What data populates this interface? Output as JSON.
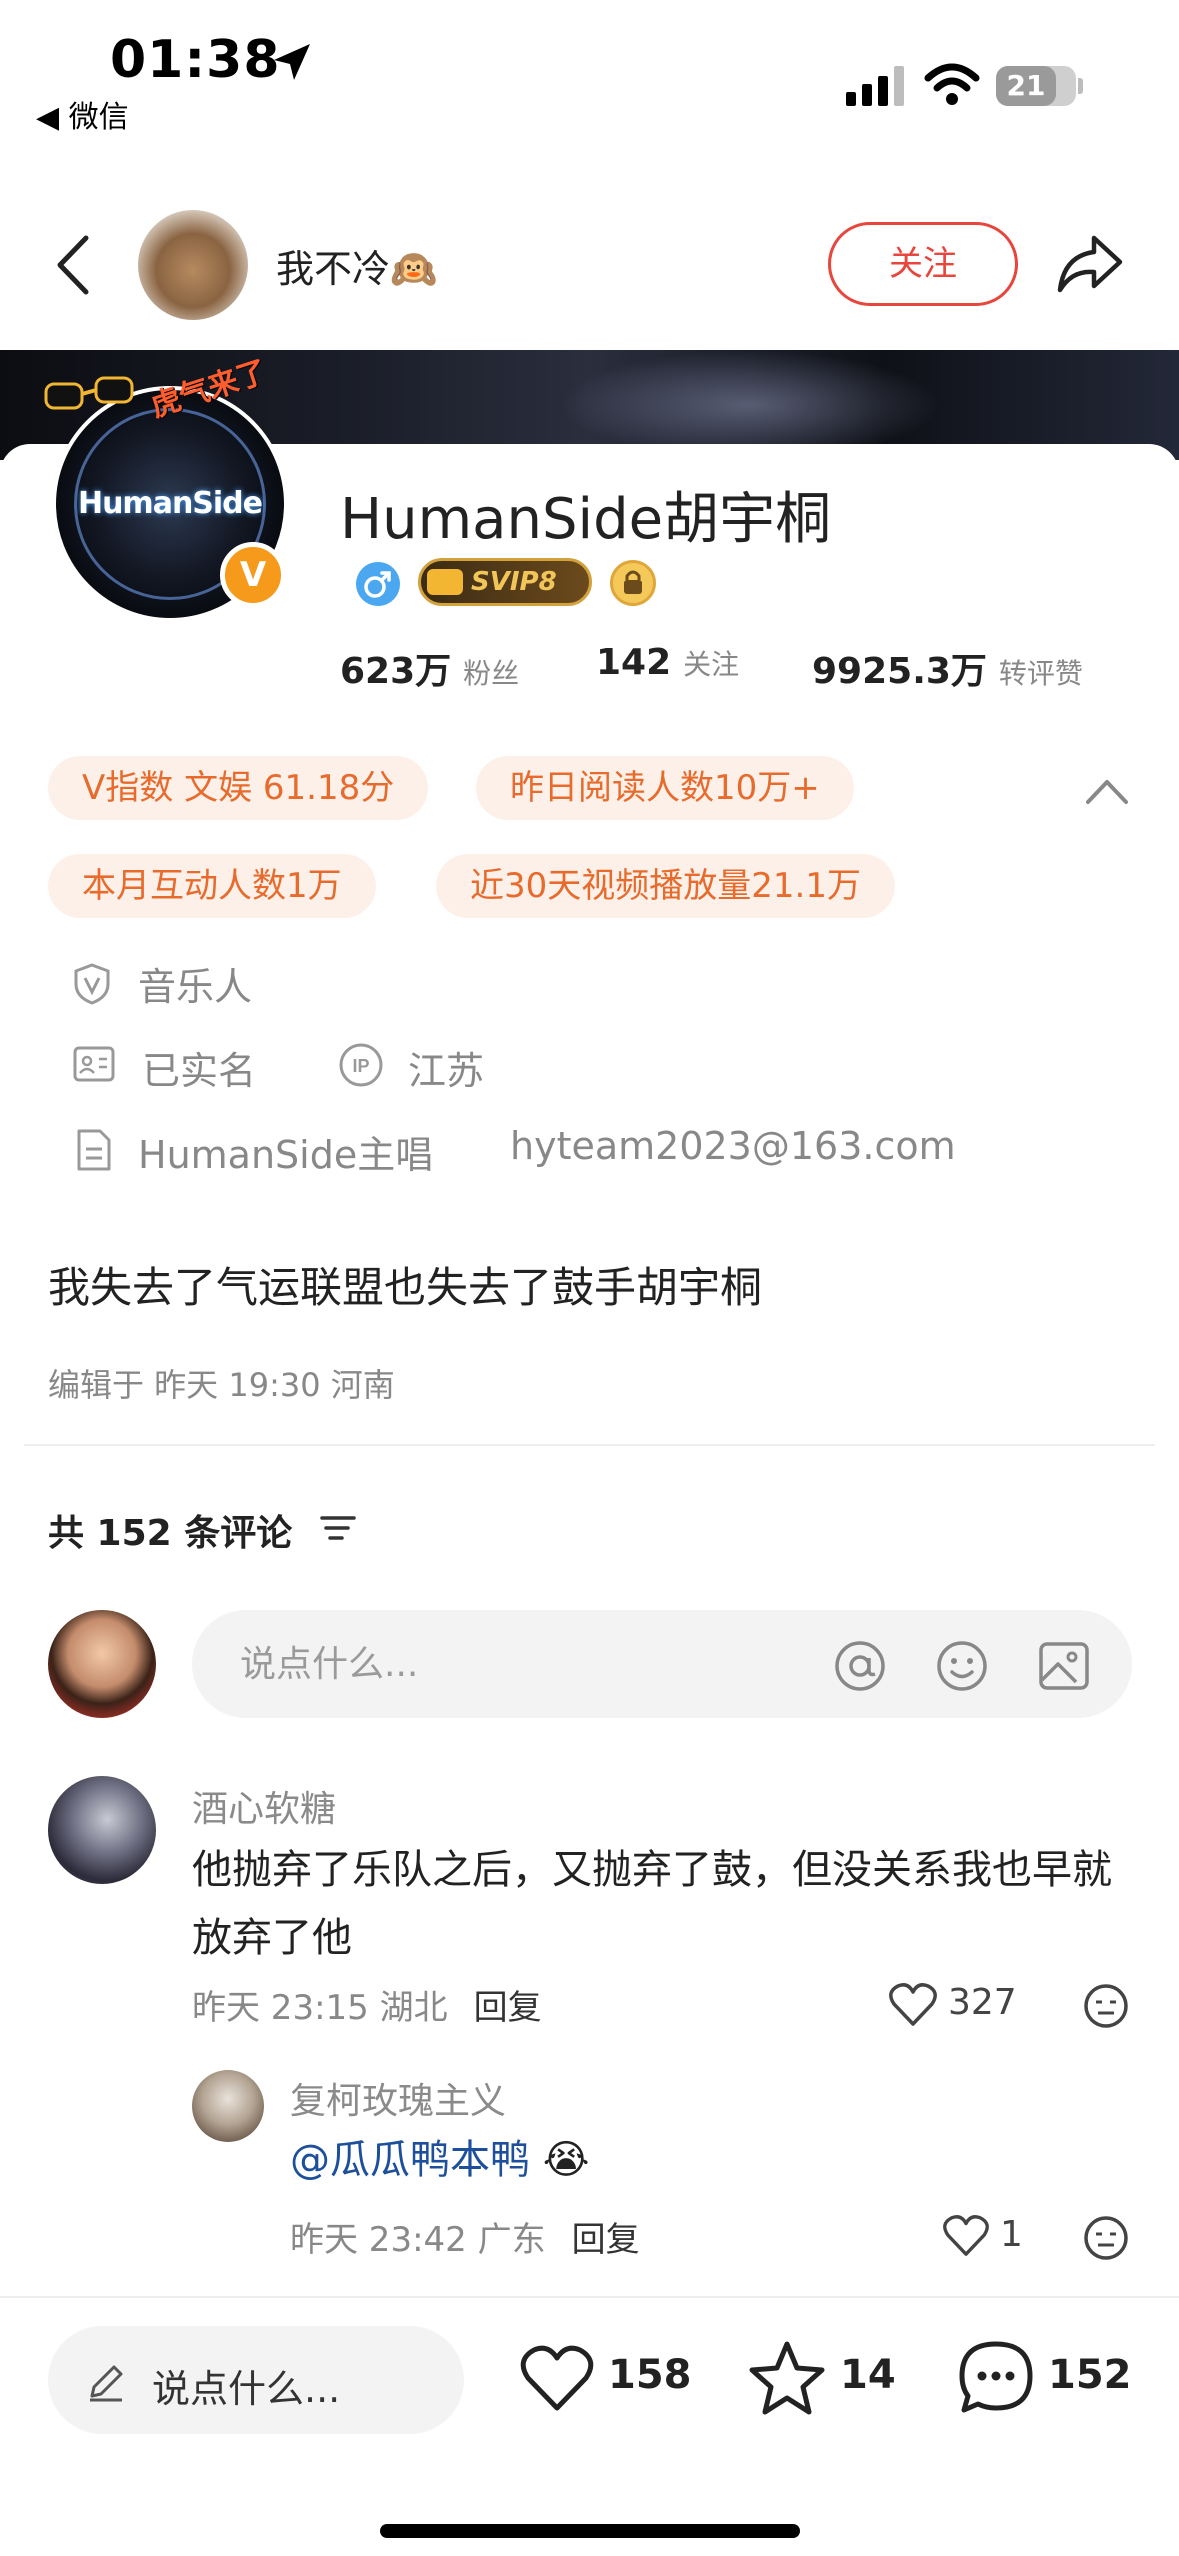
{
  "status_bar": {
    "time": "01:38",
    "back_app": "◀ 微信",
    "battery": "21"
  },
  "header": {
    "username": "我不冷🙉",
    "follow_label": "关注"
  },
  "profile": {
    "avatar_text": "HumanSide",
    "sticker_text": "虎气来了",
    "verified_badge": "V",
    "name": "HumanSide胡宇桐",
    "vip_badge": "SVIP8",
    "stats": [
      {
        "value": "623万",
        "label": "粉丝"
      },
      {
        "value": "142",
        "label": "关注"
      },
      {
        "value": "9925.3万",
        "label": "转评赞"
      }
    ],
    "tags": [
      "V指数 文娱 61.18分",
      "昨日阅读人数10万+",
      "本月互动人数1万",
      "近30天视频播放量21.1万"
    ],
    "info": {
      "category": "音乐人",
      "realname": "已实名",
      "ip_location": "江苏",
      "bio": "HumanSide主唱",
      "email": "hyteam2023@163.com"
    }
  },
  "post": {
    "text": "我失去了气运联盟也失去了鼓手胡宇桐",
    "meta": "编辑于 昨天 19:30 河南"
  },
  "comments_section": {
    "count_label": "共 152 条评论",
    "input_placeholder": "说点什么...",
    "comments": [
      {
        "name": "酒心软糖",
        "text": "他抛弃了乐队之后，又抛弃了鼓，但没关系我也早就放弃了他",
        "time_loc": "昨天 23:15 湖北",
        "reply_label": "回复",
        "likes": "327"
      }
    ],
    "replies": [
      {
        "name": "复柯玫瑰主义",
        "mention": "@瓜瓜鸭本鸭",
        "emoji": "😭",
        "time_loc": "昨天 23:42 广东",
        "reply_label": "回复",
        "likes": "1"
      }
    ]
  },
  "bottom_bar": {
    "input_label": "说点什么...",
    "likes": "158",
    "favorites": "14",
    "comments": "152"
  },
  "colors": {
    "accent_red": "#e8453c",
    "tag_orange": "#e76b2c",
    "tag_bg": "#fdf0e8",
    "mention_blue": "#1d4f9a"
  },
  "icons": [
    "location-arrow-icon",
    "signal-icon",
    "wifi-icon",
    "battery-icon",
    "back-chevron-icon",
    "share-icon",
    "gender-male-icon",
    "svip-crown-icon",
    "lock-icon",
    "chevron-up-icon",
    "verified-shield-icon",
    "id-card-icon",
    "ip-icon",
    "document-icon",
    "sort-icon",
    "at-icon",
    "emoji-icon",
    "image-icon",
    "heart-icon",
    "dislike-face-icon",
    "pencil-icon",
    "star-icon",
    "comment-bubble-icon"
  ]
}
